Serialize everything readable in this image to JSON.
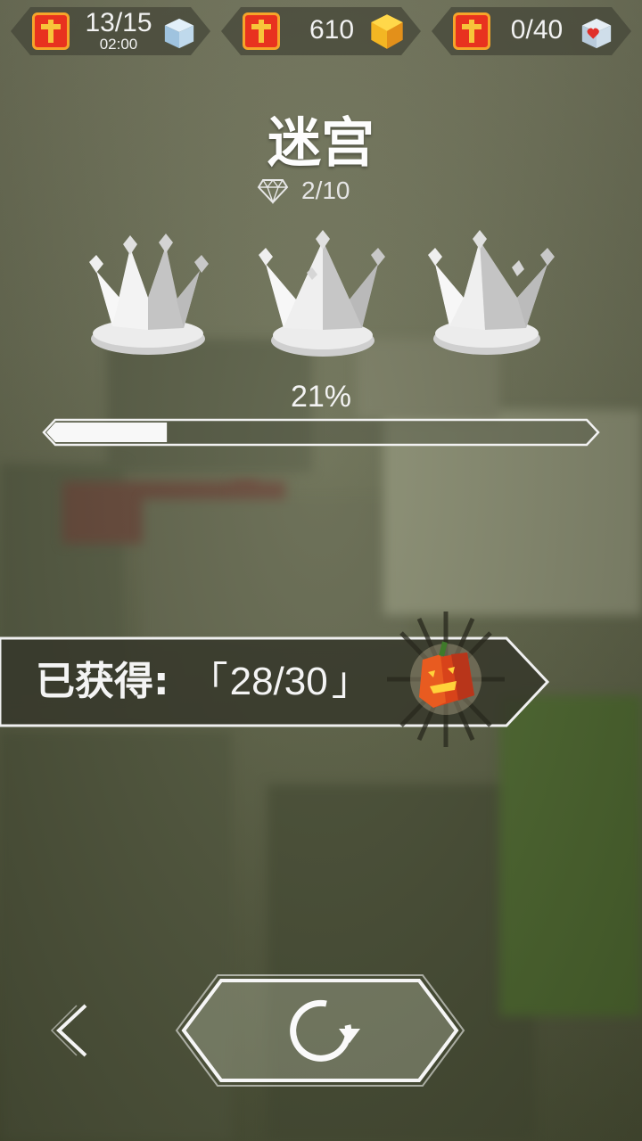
{
  "hud": {
    "lives": {
      "count": "13/15",
      "timer": "02:00",
      "badge_icon": "cross-badge-icon",
      "item_icon": "ice-cube-icon"
    },
    "coins": {
      "count": "610",
      "badge_icon": "cross-badge-icon",
      "item_icon": "gold-cube-icon"
    },
    "hearts": {
      "count": "0/40",
      "badge_icon": "cross-badge-icon",
      "item_icon": "heart-cube-icon"
    }
  },
  "level": {
    "title": "迷宫",
    "gems": "2/10",
    "gem_icon": "diamond-icon",
    "crowns_earned": 0,
    "crowns_total": 3
  },
  "progress": {
    "percent_label": "21%",
    "fraction": 0.21
  },
  "collected": {
    "label": "已获得:",
    "open_bracket": "「",
    "value": "28/30",
    "close_bracket": "」",
    "icon": "pumpkin-block-icon"
  },
  "controls": {
    "back_icon": "chevron-left-icon",
    "replay_icon": "replay-icon"
  },
  "colors": {
    "badge_red": "#e8321f",
    "badge_gold": "#f7c53a",
    "pumpkin": "#e0501c",
    "crown_silver": "#e3e3e3"
  }
}
